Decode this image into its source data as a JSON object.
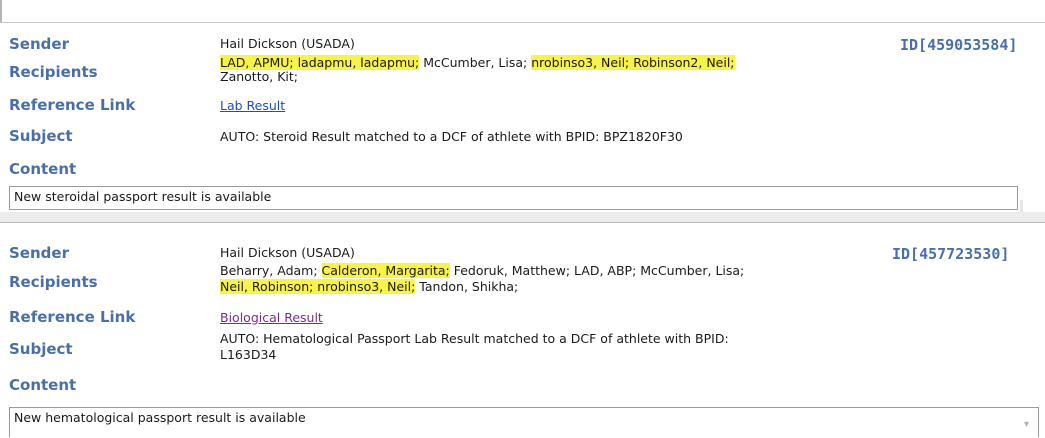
{
  "labels": {
    "sender": "Sender",
    "recipients": "Recipients",
    "reference_link": "Reference Link",
    "subject": "Subject",
    "content": "Content"
  },
  "messages": [
    {
      "id": "ID[459053584]",
      "sender": "Hail Dickson (USADA)",
      "recipients_line1_a": "LAD, APMU; ladapmu, ladapmu;",
      "recipients_line1_b": " McCumber, Lisa; ",
      "recipients_line1_c": "nrobinso3, Neil; Robinson2, Neil;",
      "recipients_line2": "Zanotto, Kit;",
      "reference_link": "Lab Result",
      "subject": "AUTO: Steroid Result matched to a DCF of athlete with BPID: BPZ1820F30",
      "content": "New steroidal passport result is available"
    },
    {
      "id": "ID[457723530]",
      "sender": "Hail Dickson (USADA)",
      "recipients_line1_a": "Beharry, Adam; ",
      "recipients_line1_b": "Calderon, Margarita;",
      "recipients_line1_c": " Fedoruk, Matthew; LAD, ABP; McCumber, Lisa;",
      "recipients_line2_a": "Neil, Robinson; nrobinso3, Neil;",
      "recipients_line2_b": " Tandon, Shikha;",
      "reference_link": "Biological Result",
      "subject_line1": "AUTO: Hematological Passport Lab Result matched to a DCF of athlete with BPID:",
      "subject_line2": "L163D34",
      "content": "New hematological passport result is available"
    }
  ],
  "colors": {
    "label": "#4a6fa8",
    "highlight": "#f7f34a",
    "link_1": "#1f4fb0",
    "link_2": "#7a2b8f"
  }
}
